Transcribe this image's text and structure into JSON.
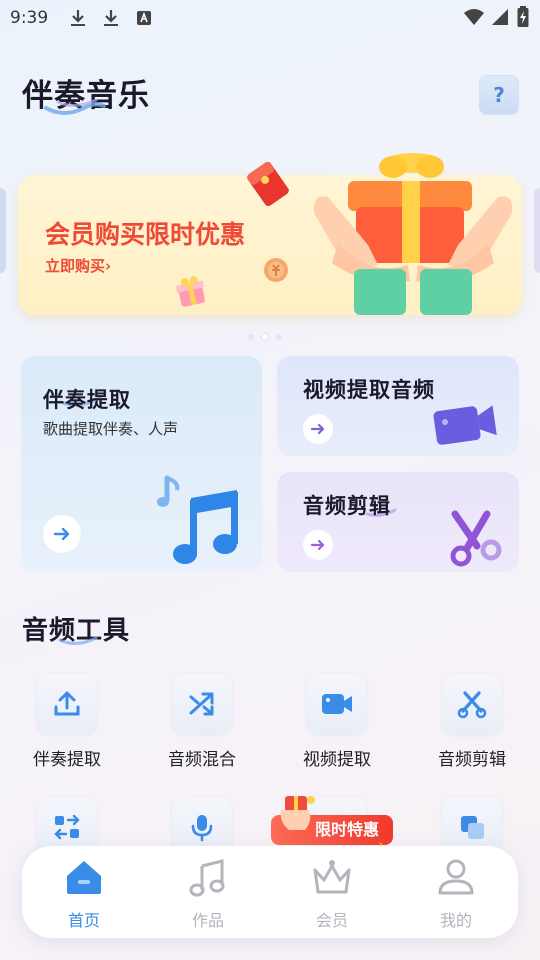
{
  "status_bar": {
    "time": "9:39"
  },
  "header": {
    "title": "伴奏音乐",
    "help_label": "?"
  },
  "banner": {
    "title": "会员购买限时优惠",
    "link": "立即购买",
    "link_arrow": "›",
    "pages": 3,
    "active_page": 2
  },
  "feature_cards": {
    "accompaniment": {
      "title": "伴奏提取",
      "subtitle": "歌曲提取伴奏、人声"
    },
    "video_audio": {
      "title": "视频提取音频"
    },
    "audio_cut": {
      "title": "音频剪辑"
    }
  },
  "tools": {
    "title": "音频工具",
    "items": [
      {
        "label": "伴奏提取",
        "icon": "upload-icon"
      },
      {
        "label": "音频混合",
        "icon": "shuffle-icon"
      },
      {
        "label": "视频提取",
        "icon": "video-camera-icon"
      },
      {
        "label": "音频剪辑",
        "icon": "scissors-icon"
      }
    ],
    "row2_icons": [
      "convert-icon",
      "microphone-icon",
      "waveform-icon",
      "copy-icon"
    ]
  },
  "promo": {
    "label": "限时特惠"
  },
  "tabbar": {
    "items": [
      {
        "label": "首页",
        "icon": "home-icon",
        "active": true
      },
      {
        "label": "作品",
        "icon": "music-note-icon",
        "active": false
      },
      {
        "label": "会员",
        "icon": "crown-icon",
        "active": false
      },
      {
        "label": "我的",
        "icon": "user-icon",
        "active": false
      }
    ]
  },
  "colors": {
    "accent": "#3b8be8",
    "promo_red": "#ef4a35",
    "tab_inactive": "#b4b4bd"
  }
}
